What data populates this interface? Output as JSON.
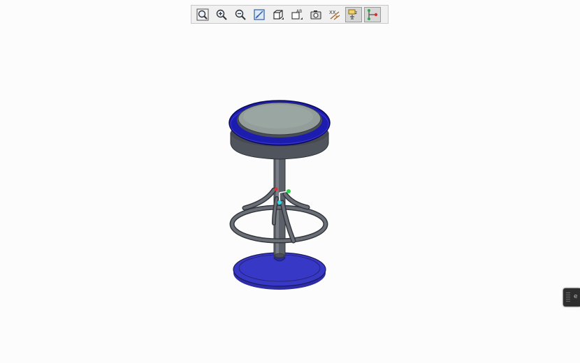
{
  "toolbar": {
    "buttons": [
      {
        "icon": "zoom-fit-icon",
        "active": false
      },
      {
        "icon": "zoom-in-icon",
        "active": false
      },
      {
        "icon": "zoom-out-icon",
        "active": false
      },
      {
        "icon": "repaint-icon",
        "active": false
      },
      {
        "icon": "display-style-icon",
        "active": false
      },
      {
        "icon": "saved-orientations-icon",
        "active": false
      },
      {
        "icon": "view-manager-icon",
        "active": false
      },
      {
        "icon": "datum-display-icon",
        "active": false
      },
      {
        "icon": "annotation-display-icon",
        "active": true
      },
      {
        "icon": "spin-center-icon",
        "active": true
      }
    ],
    "annotation_label": "AB",
    "plane_label": "XX"
  },
  "model": {
    "seat_top_color": "#8e9c98",
    "seat_rim_color": "#1a1ab0",
    "frame_color": "#5a5e66",
    "base_color": "#3535c8"
  },
  "corner_widget": {
    "label": "e"
  }
}
